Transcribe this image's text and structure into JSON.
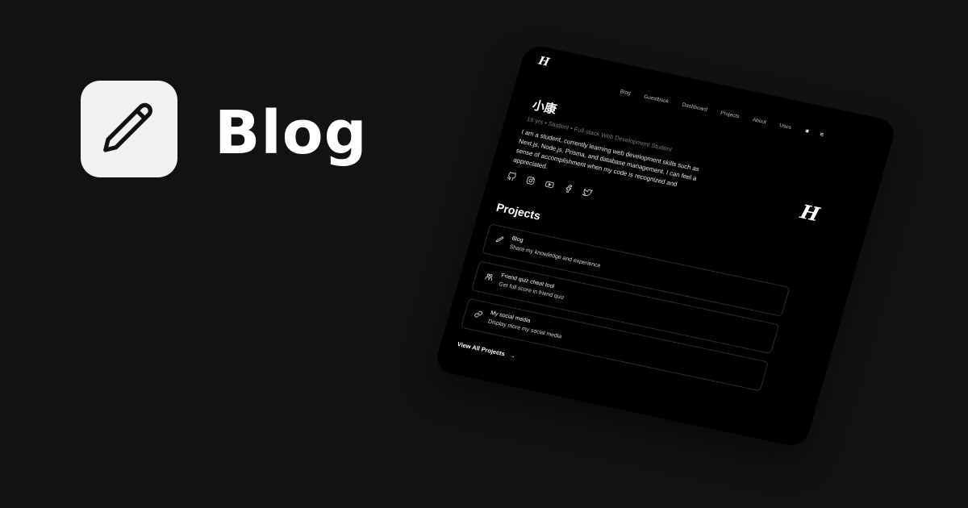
{
  "brand": {
    "icon": "pencil-icon",
    "title": "Blog",
    "icon_bg": "#f1f1f1",
    "bg": "#121212"
  },
  "screen": {
    "logo": "H",
    "nav": {
      "items": [
        "Blog",
        "Guestbook",
        "Dashboard",
        "Projects",
        "About",
        "Uses"
      ],
      "theme_icon": "sun-icon",
      "menu_icon": "menu-icon"
    },
    "hero": {
      "name": "小康",
      "subtitle": "16 yrs • Student • Full-stack Web Development Student",
      "bio": "I am a student, currently learning web development skills such as Next.js, Node.js, Prisma, and database management. I can feel a sense of accomplishment when my code is recognized and appreciated.",
      "social_icons": [
        "github-icon",
        "instagram-icon",
        "youtube-icon",
        "facebook-icon",
        "twitter-icon"
      ],
      "big_logo": "H"
    },
    "projects": {
      "heading": "Projects",
      "items": [
        {
          "icon": "pencil-icon",
          "title": "Blog",
          "description": "Share my knowledge and experience"
        },
        {
          "icon": "people-icon",
          "title": "Friend quiz cheat tool",
          "description": "Get full score in friend quiz"
        },
        {
          "icon": "link-icon",
          "title": "My social media",
          "description": "Display more my social media"
        }
      ],
      "view_all": "View All Projects",
      "view_all_arrow": "→"
    }
  }
}
